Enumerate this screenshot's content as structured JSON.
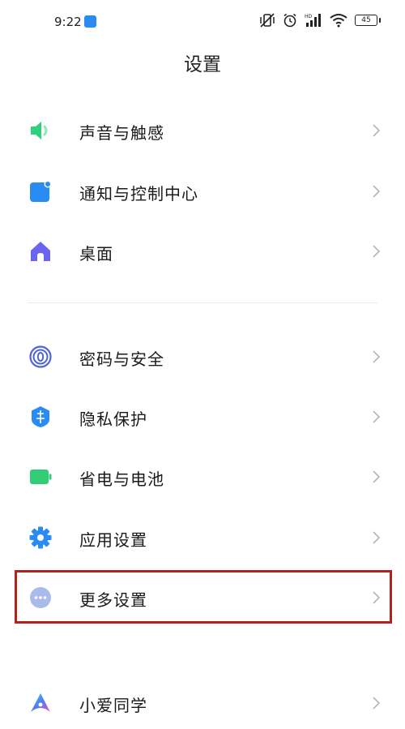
{
  "status_bar": {
    "time": "9:22",
    "battery": "45"
  },
  "page": {
    "title": "设置"
  },
  "settings": [
    {
      "label": "声音与触感"
    },
    {
      "label": "通知与控制中心"
    },
    {
      "label": "桌面"
    },
    {
      "label": "密码与安全"
    },
    {
      "label": "隐私保护"
    },
    {
      "label": "省电与电池"
    },
    {
      "label": "应用设置"
    },
    {
      "label": "更多设置",
      "highlighted": true
    },
    {
      "label": "小爱同学"
    }
  ],
  "colors": {
    "sound": "#2fd17c",
    "notification": "#2a8bf2",
    "desktop": "#6b64ee",
    "password": "#4f63d6",
    "privacy": "#2a8bf2",
    "battery": "#33cd78",
    "apps": "#2a8bf2",
    "more": "#a9bbea",
    "highlight": "#b2231f"
  }
}
